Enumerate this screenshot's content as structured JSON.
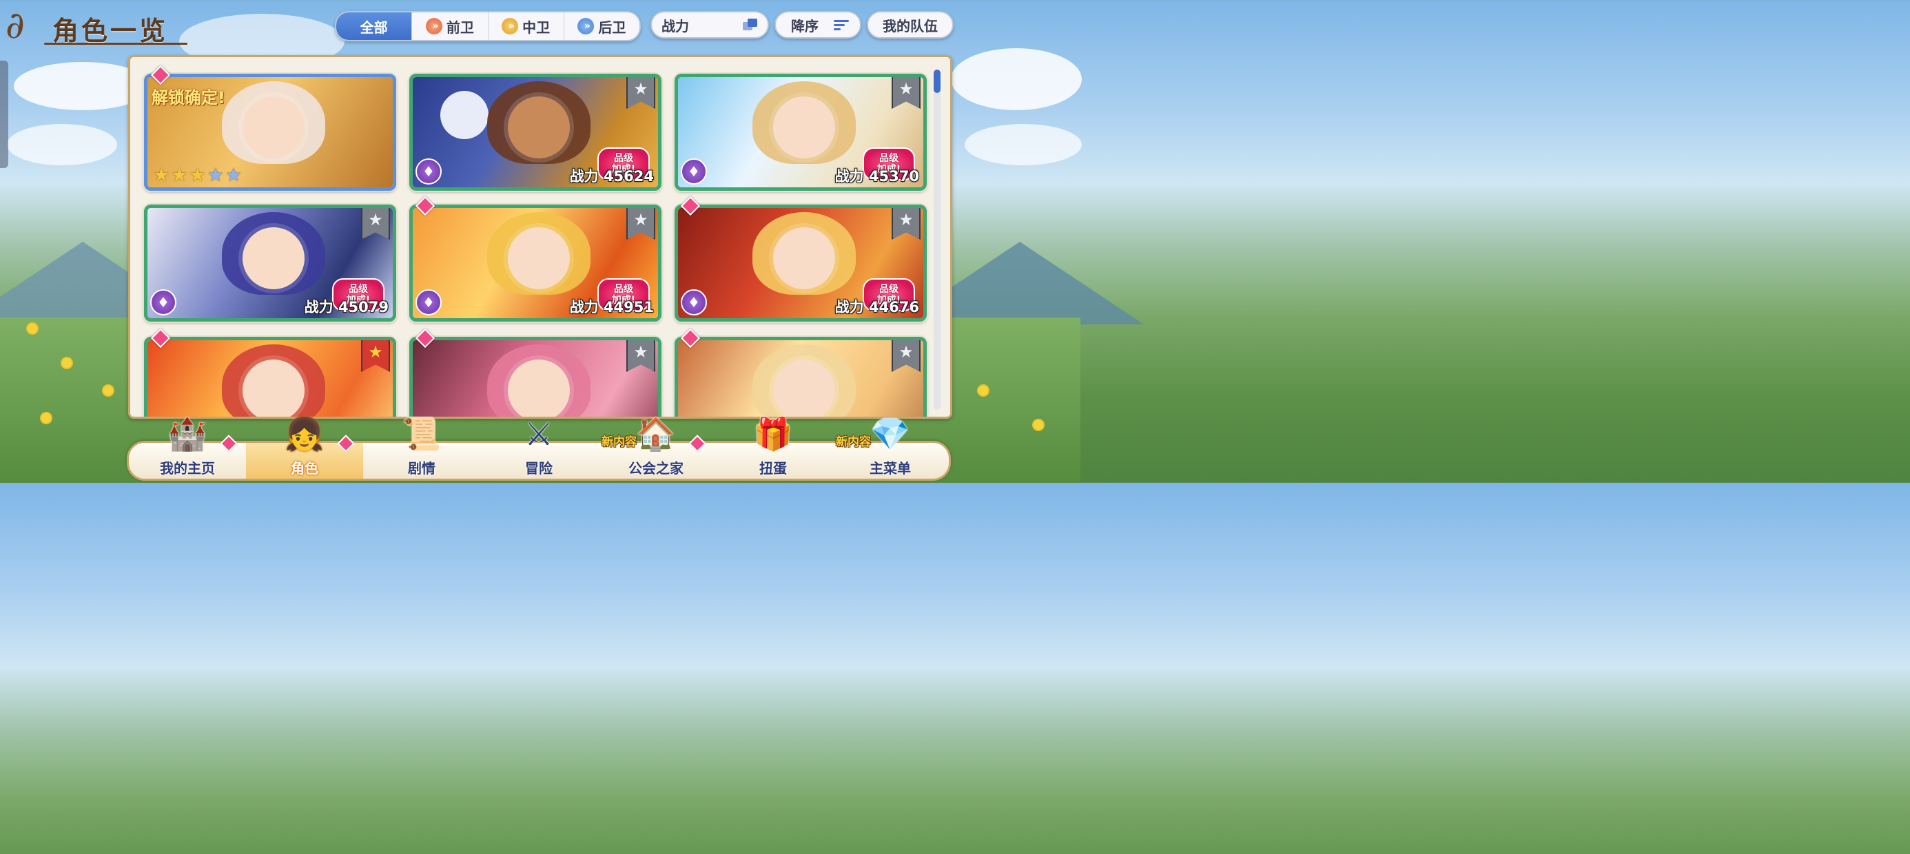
{
  "title": "角色一览",
  "title_swirl": "∂",
  "filters": {
    "tabs": [
      {
        "label": "全部",
        "icon": "",
        "active": true
      },
      {
        "label": "前卫",
        "icon": "front-position-icon",
        "active": false
      },
      {
        "label": "中卫",
        "icon": "middle-position-icon",
        "active": false
      },
      {
        "label": "后卫",
        "icon": "back-position-icon",
        "active": false
      }
    ],
    "chevron_glyph": "»",
    "sort_field": "战力",
    "sort_order": "降序",
    "my_team": "我的队伍"
  },
  "colors": {
    "accent": "#3f6fcb",
    "card_border": "#3fa672",
    "locked_border": "#5b8fe0",
    "panel_border": "#c8a66a"
  },
  "cards": [
    {
      "power_label": "",
      "power": "",
      "unlock_text": "解锁确定!",
      "stars_on": 3,
      "stars_off": 2,
      "star_glyph": "★",
      "locked": true,
      "bonus": "",
      "rank_glyph": "",
      "role_glyph": ""
    },
    {
      "power_label": "战力",
      "power": "45624",
      "bonus_line1": "品级",
      "bonus_line2": "加成!",
      "rank_glyph": "★",
      "role_glyph": "♦"
    },
    {
      "power_label": "战力",
      "power": "45370",
      "bonus_line1": "品级",
      "bonus_line2": "加成!",
      "rank_glyph": "★",
      "role_glyph": "♦"
    },
    {
      "power_label": "战力",
      "power": "45079",
      "bonus_line1": "品级",
      "bonus_line2": "加成!",
      "rank_glyph": "★",
      "role_glyph": "♦"
    },
    {
      "power_label": "战力",
      "power": "44951",
      "bonus_line1": "品级",
      "bonus_line2": "加成!",
      "rank_glyph": "★",
      "role_glyph": "♦"
    },
    {
      "power_label": "战力",
      "power": "44676",
      "bonus_line1": "品级",
      "bonus_line2": "加成!",
      "rank_glyph": "★",
      "role_glyph": "♦"
    },
    {
      "rank_glyph": "★"
    },
    {
      "rank_glyph": "★"
    },
    {
      "rank_glyph": "★"
    }
  ],
  "nav": {
    "items": [
      {
        "label": "我的主页",
        "icon": "castle-icon",
        "glyph": "🏰",
        "new_label": "",
        "active": false
      },
      {
        "label": "角色",
        "icon": "character-icon",
        "glyph": "👧",
        "new_label": "",
        "active": true
      },
      {
        "label": "剧情",
        "icon": "scroll-icon",
        "glyph": "📜",
        "new_label": "",
        "active": false
      },
      {
        "label": "冒险",
        "icon": "flag-sword-icon",
        "glyph": "⚔",
        "new_label": "",
        "active": false
      },
      {
        "label": "公会之家",
        "icon": "guild-house-icon",
        "glyph": "🏠",
        "new_label": "新内容",
        "active": false
      },
      {
        "label": "扭蛋",
        "icon": "gacha-icon",
        "glyph": "🎁",
        "new_label": "",
        "active": false
      },
      {
        "label": "主菜单",
        "icon": "crystal-icon",
        "glyph": "💎",
        "new_label": "新内容",
        "active": false
      }
    ]
  }
}
